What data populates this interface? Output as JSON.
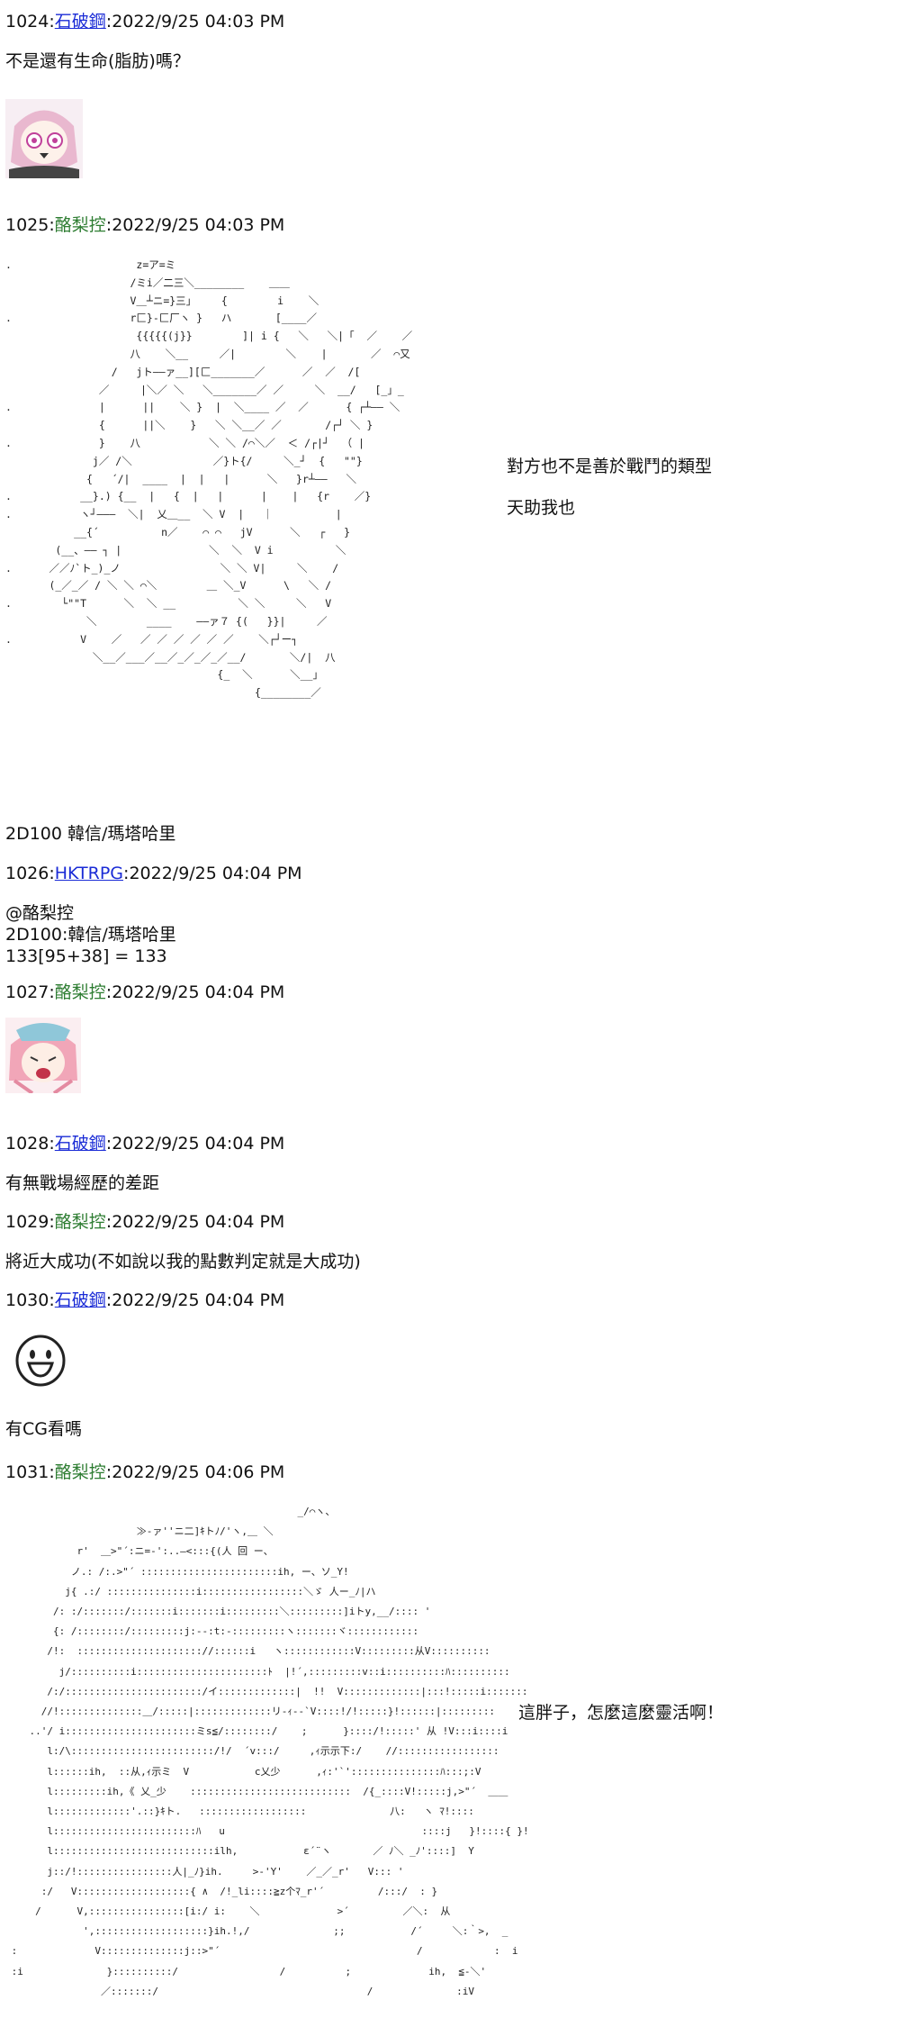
{
  "posts": [
    {
      "num": "1024",
      "name": "石破鋼",
      "date": "2022/9/25 04:03 PM",
      "text": "不是還有生命(脂肪)嗎？"
    },
    {
      "num": "1025",
      "name": "酪梨控",
      "date": "2022/9/25 04:03 PM",
      "aa_side_1": "對方也不是善於戰鬥的類型",
      "aa_side_2": "天助我也",
      "text": "2D100 韓信/瑪塔哈里"
    },
    {
      "num": "1026",
      "name": "HKTRPG",
      "date": "2022/9/25 04:04 PM",
      "lines": [
        "@酪梨控",
        "2D100:韓信/瑪塔哈里",
        "133[95+38] = 133"
      ]
    },
    {
      "num": "1027",
      "name": "酪梨控",
      "date": "2022/9/25 04:04 PM"
    },
    {
      "num": "1028",
      "name": "石破鋼",
      "date": "2022/9/25 04:04 PM",
      "text": "有無戰場經歷的差距"
    },
    {
      "num": "1029",
      "name": "酪梨控",
      "date": "2022/9/25 04:04 PM",
      "text": "將近大成功(不如說以我的點數判定就是大成功)"
    },
    {
      "num": "1030",
      "name": "石破鋼",
      "date": "2022/9/25 04:04 PM",
      "text": "有CG看嗎"
    },
    {
      "num": "1031",
      "name": "酪梨控",
      "date": "2022/9/25 04:06 PM",
      "aa_side": "這胖子，怎麼這麼靈活啊！"
    }
  ],
  "aa1": [
    ".                    z=ア=ミ",
    "                    /ミi／二三＼________    ＿＿",
    "                    V＿┴ニ=}三」    {        i    ＼",
    ".                   r匚}-匚厂ヽ }   ハ       [____／",
    "                     {{{{{(j}}        ]| i {   ＼   ＼|「  ／    ／",
    "                    八    ＼__     ／|        ＼    |       ／  ⌒又",
    "                 /   jト――ァ__][匚_______／      ／  ／  /[",
    "               ／     |＼／ ＼   ＼_______／ ／     ＼  __/   [_」_",
    ".              |      ||    ＼ }  |  ＼____ ／  ／      { ┌┴―― ＼",
    "               {      ||＼    }   ＼ ＼__／ ／       /┌┘ ＼ }",
    ".              }    八           ＼ ＼ /⌒＼／  ＜ /┌|┘  （ |",
    "              j／ /＼             ／}ト{/     ＼_┘  {   \"\"}",
    "             {   ´/|  ____  |  |   |      ＼   }r┴――   ＼",
    ".           __}.) {__  |   {  |   |      |    |   {r    ／}",
    ".           ヽ┘―――  ＼|  乂＿__  ＼ V  |   ｜          |",
    "           __{´          n／    ⌒ ⌒   jV      ＼   ┌   }",
    "        (__、―― ┐ |              ＼  ＼  V i          ＼",
    ".      ／／ﾉ`ト_)_ノ                ＼ ＼ V|     ＼    /",
    "       (_／_／ / ＼ ＼ ⌒＼        ＿ ＼_V      \\   ＼ /",
    ".        └\"\"T      ＼  ＼ __          ＼ ＼     ＼   V",
    "             ＼        ____    ――ァ７ {(   }}|     ／",
    ".           V    ／   ／ ／ ／ ／ ／ ／    ＼┌┘ー┐",
    "              ＼__／___／__／_／_／_／__/       ＼/|  八",
    "                                  {_  ＼      ＼__」",
    "                                        {________／"
  ],
  "aa2": [
    "                                                 _/⌒ヽ、",
    "                      ≫-ァ''ニ二]ｷトﾉ/'ヽ,＿ ＼",
    "            r'  ＿>\"´:ニ=-':..―<:::{(人 回 ー、",
    "           ノ.: /:.>\"´ :::::::::::::::::::::::ih, ー、ソ_Y! ",
    "          j{ .:/ :::::::::::::::i:::::::::::::::::＼ゞ 人ー_ﾉ|ハ",
    "        /: :/:::::::/:::::::i:::::::i:::::::::＼:::::::::]iトy,__/:::: '",
    "        {: /::::::::/:::::::::j:-‐:t:-:::::::::ヽ:::::::ヾ::::::::::::",
    "       /!:  ::::::::::::::::::::://::::::i   ヽ::::::::::::V:::::::::从V::::::::::",
    "         j/::::::::::i::::::::::::::::::::::ﾄ  |!´,:::::::::v::i::::::::::ﾊ::::::::::",
    "       /:/:::::::::::::::::::::::/イ:::::::::::::|  !!  V:::::::::::::|:::!:::::i:::::::::::",
    "      //!::::::::::::::＿/:::::|:::::::::::::リ-ｨ--`V::::!/!:::::}!::::::|:::::::::",
    "    ..'/ i::::::::::::::::::::::ミs≦/::::::::/    ;      }::::/!:::::' 从 !V:::i::::i",
    "       l:/\\::::::::::::::::::::::::/!/  ´v:::/     ,ｨ示示下:/    //:::::::::::::::::",
    "       l::::::ih,  ::从,ｨ示ミ  V           c乂少      ,ｨ:'`':::::::::::::::ﾊ:::;:V",
    "       l:::::::::ih,《 乂_少    :::::::::::::::::::::::::::  /{_::::V!:::::j,>\"´  ＿＿",
    "       l:::::::::::::'.::}ｷト.   ::::::::::::::::::              八:   ヽ ﾏ!::::",
    "       l::::::::::::::::::::::::ﾊ   u                                 ::::j   }!::::{ }!",
    "       l:::::::::::::::::::::::::::ilh,           ε´¨ヽ       ／ ﾉ＼ _ﾉ'::::]  Y",
    "       j::/!::::::::::::::::人|_ﾉ}ih.     >-'Y'    ／_／_r'   V::: '",
    "      :/   V:::::::::::::::::::{ ∧  /!_li::::≧z个ﾏ_r'´         /:::/  : }",
    "     /      V,::::::::::::::::[i:/ i:    ＼             >´         ／＼:  从",
    "             ',:::::::::::::::::::}ih.!,/              ;;           /´     ＼:｀>,  _",
    " :             V::::::::::::::j::>\"´                                 /            :  i  i",
    " :i              }::::::::::/                 /          ;             ih,  ≦-＼'",
    "                ／:::::::/                                   /              :iV"
  ]
}
